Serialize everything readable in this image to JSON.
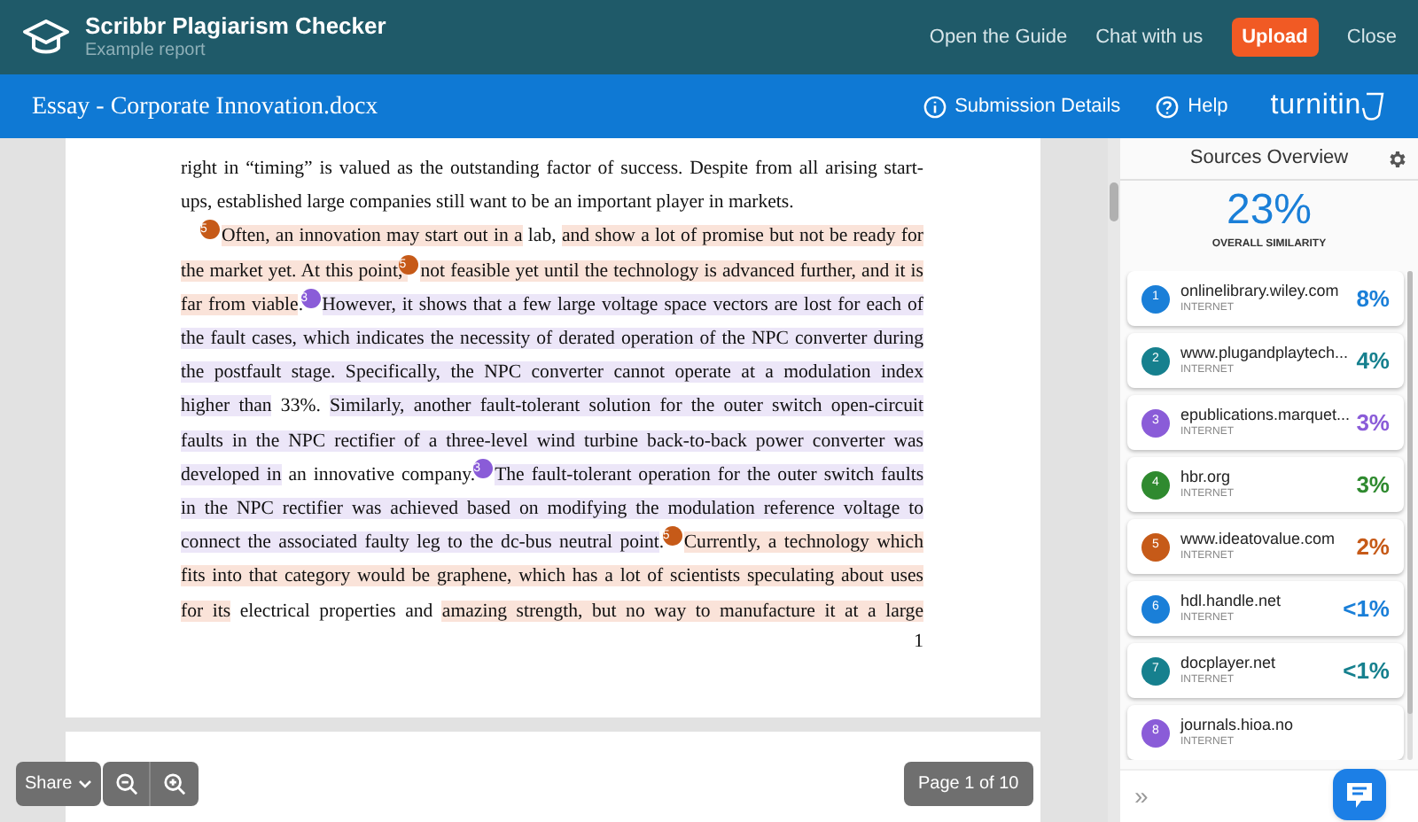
{
  "app": {
    "title": "Scribbr Plagiarism Checker",
    "subtitle": "Example report",
    "links": [
      "Open the Guide",
      "Chat with us"
    ],
    "upload": "Upload",
    "close": "Close"
  },
  "document_bar": {
    "title": "Essay - Corporate Innovation.docx",
    "submission_details": "Submission Details",
    "help": "Help",
    "logo": "turnitin"
  },
  "document": {
    "page_number": "1",
    "paragraphs": [
      {
        "indented": false,
        "lines": [
          [
            {
              "text": "right in “timing” is valued as the outstanding factor of success. Despite from all arising start-"
            }
          ],
          [
            {
              "text": "ups, established large companies still want to be an important player in markets."
            }
          ]
        ]
      },
      {
        "indented": true,
        "lines": [
          [
            {
              "marker": {
                "label": "5",
                "color": "#c65a18"
              },
              "color": "#fae3d9",
              "text": "Often, an innovation may start out in a"
            },
            {
              "text": " lab, "
            },
            {
              "color": "#fae3d9",
              "text": "and show a lot of promise but not be ready for"
            }
          ],
          [
            {
              "color": "#fae3d9",
              "text": "the market yet. At this point, "
            },
            {
              "marker": {
                "label": "5",
                "color": "#c65a18"
              },
              "color": "#fae3d9",
              "text": "not feasible yet until the technology is advanced further, and it is"
            }
          ],
          [
            {
              "color": "#fae3d9",
              "text": "far from viable"
            },
            {
              "text": ". "
            },
            {
              "marker": {
                "label": "3",
                "color": "#8a5cd8"
              },
              "color": "#ece6f8",
              "text": "However, it shows that a few large voltage space vectors are lost for each of"
            }
          ],
          [
            {
              "color": "#ece6f8",
              "text": "the fault cases, which indicates the necessity of derated operation of the NPC converter during"
            }
          ],
          [
            {
              "color": "#ece6f8",
              "text": "the postfault stage. Specifically, the NPC converter cannot operate at a modulation index"
            }
          ],
          [
            {
              "color": "#ece6f8",
              "text": "higher than"
            },
            {
              "text": " 33%. "
            },
            {
              "color": "#ece6f8",
              "text": "Similarly, another fault-tolerant solution for the outer switch open-circuit"
            }
          ],
          [
            {
              "color": "#ece6f8",
              "text": "faults in the NPC rectifier of a three-level wind turbine back-to-back power converter was"
            }
          ],
          [
            {
              "color": "#ece6f8",
              "text": "developed in"
            },
            {
              "text": " an innovative company. "
            },
            {
              "marker": {
                "label": "3",
                "color": "#8a5cd8"
              },
              "color": "#ece6f8",
              "text": "The fault-tolerant operation for the outer switch faults"
            }
          ],
          [
            {
              "color": "#ece6f8",
              "text": "in the NPC rectifier was achieved based on modifying the modulation reference voltage to"
            }
          ],
          [
            {
              "color": "#ece6f8",
              "text": "connect the associated faulty leg to the dc-bus neutral point"
            },
            {
              "text": ". "
            },
            {
              "marker": {
                "label": "5",
                "color": "#c65a18"
              },
              "color": "#fae3d9",
              "text": "Currently, a technology which"
            }
          ],
          [
            {
              "color": "#fae3d9",
              "text": "fits into that category would be graphene, which has a lot of scientists speculating about uses"
            }
          ],
          [
            {
              "color": "#fae3d9",
              "text": "for its"
            },
            {
              "text": " electrical properties and "
            },
            {
              "color": "#fae3d9",
              "text": "amazing strength, but no way to manufacture it at a large"
            }
          ]
        ]
      }
    ]
  },
  "toolbar": {
    "share": "Share",
    "page": "Page 1 of 10"
  },
  "sources": {
    "title": "Sources Overview",
    "overall": "23%",
    "overall_label": "OVERALL SIMILARITY",
    "items": [
      {
        "number": "1",
        "name": "onlinelibrary.wiley.com",
        "type": "INTERNET",
        "percent": "8%",
        "color": "#1a7fd8"
      },
      {
        "number": "2",
        "name": "www.plugandplaytech...",
        "type": "INTERNET",
        "percent": "4%",
        "color": "#16808e"
      },
      {
        "number": "3",
        "name": "epublications.marquet...",
        "type": "INTERNET",
        "percent": "3%",
        "color": "#8a5cd8"
      },
      {
        "number": "4",
        "name": "hbr.org",
        "type": "INTERNET",
        "percent": "3%",
        "color": "#2f8a2f"
      },
      {
        "number": "5",
        "name": "www.ideatovalue.com",
        "type": "INTERNET",
        "percent": "2%",
        "color": "#c65a18"
      },
      {
        "number": "6",
        "name": "hdl.handle.net",
        "type": "INTERNET",
        "percent": "<1%",
        "color": "#1a7fd8"
      },
      {
        "number": "7",
        "name": "docplayer.net",
        "type": "INTERNET",
        "percent": "<1%",
        "color": "#16808e"
      },
      {
        "number": "8",
        "name": "journals.hioa.no",
        "type": "INTERNET",
        "color": "#8a5cd8"
      }
    ]
  },
  "collapse": "»"
}
